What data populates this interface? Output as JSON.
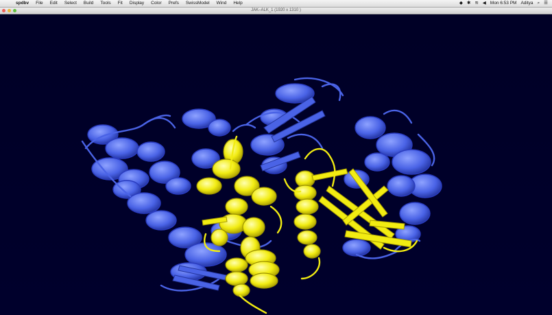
{
  "menubar": {
    "apple_glyph": "",
    "items": [
      "spdbv",
      "File",
      "Edit",
      "Select",
      "Build",
      "Tools",
      "Fit",
      "Display",
      "Color",
      "Prefs",
      "SwissModel",
      "Wind",
      "Help"
    ],
    "clock": "Mon 6:53 PM",
    "user": "Aditya"
  },
  "window": {
    "title": "JAK–ALK_1 (1920 x 1310 )"
  },
  "colors": {
    "background": "#00002a",
    "blue_domain": "#4a63e6",
    "yellow_domain": "#f2ec12"
  },
  "viewport": {
    "molecule_domains": [
      "blue-domain",
      "yellow-domain"
    ]
  }
}
